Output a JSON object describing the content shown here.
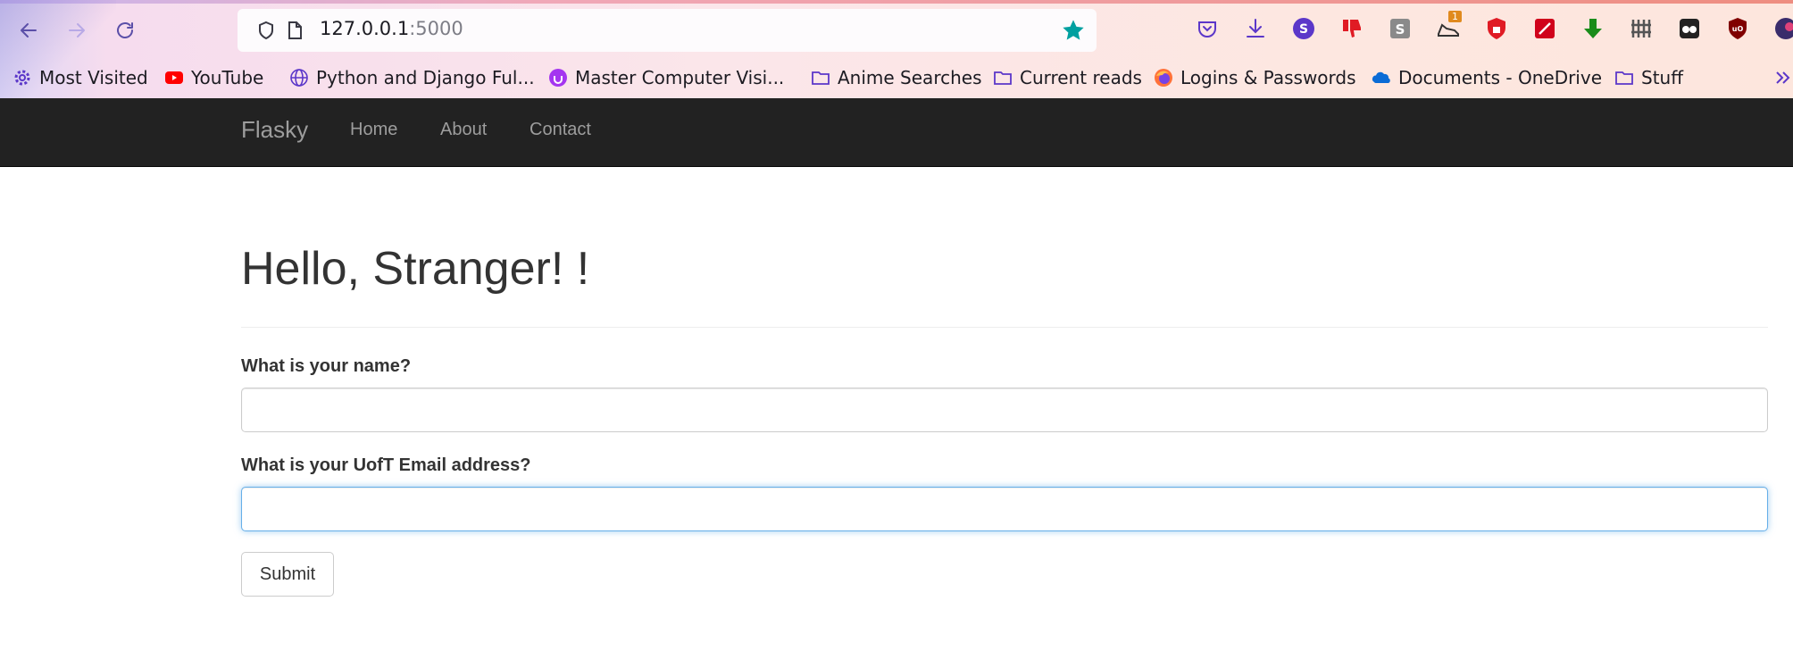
{
  "browser": {
    "url_host": "127.0.0.1",
    "url_port": ":5000",
    "bookmarks": [
      {
        "label": "Most Visited",
        "icon": "gear-icon"
      },
      {
        "label": "YouTube",
        "icon": "youtube-icon"
      },
      {
        "label": "Python and Django Ful...",
        "icon": "globe-icon"
      },
      {
        "label": "Master Computer Visi...",
        "icon": "udemy-icon"
      },
      {
        "label": "Anime Searches",
        "icon": "folder-icon"
      },
      {
        "label": "Current reads",
        "icon": "folder-icon"
      },
      {
        "label": "Logins & Passwords",
        "icon": "firefox-icon"
      },
      {
        "label": "Documents - OneDrive",
        "icon": "onedrive-icon"
      },
      {
        "label": "Stuff",
        "icon": "folder-icon"
      }
    ],
    "extension_badge": "1",
    "colors": {
      "star": "#00a0a0",
      "accent": "#5b37c9"
    }
  },
  "navbar": {
    "brand": "Flasky",
    "links": [
      "Home",
      "About",
      "Contact"
    ]
  },
  "page": {
    "heading": "Hello, Stranger! !",
    "form": {
      "name_label": "What is your name?",
      "name_value": "",
      "email_label": "What is your UofT Email address?",
      "email_value": "",
      "submit_label": "Submit"
    }
  }
}
